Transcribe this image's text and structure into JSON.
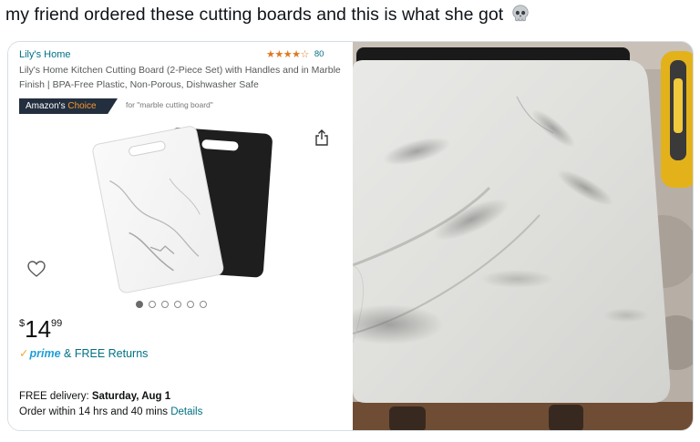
{
  "tweet": {
    "text": "my friend ordered these cutting boards and this is what she got",
    "emoji": "skull-emoji"
  },
  "listing": {
    "brand": "Lily's Home",
    "rating_stars": "★★★★☆",
    "rating_count": "80",
    "title": "Lily's Home Kitchen Cutting Board (2-Piece Set) with Handles and in Marble Finish | BPA-Free Plastic, Non-Porous, Dishwasher Safe",
    "badge_amazons": "Amazon's",
    "badge_choice": "Choice",
    "badge_for": "for \"marble cutting board\"",
    "carousel": {
      "count": 6,
      "active_index": 0
    },
    "price": {
      "currency": "$",
      "whole": "14",
      "fraction": "99"
    },
    "prime_label": "prime",
    "returns_text": "& FREE Returns",
    "delivery_prefix": "FREE delivery:",
    "delivery_date": "Saturday, Aug 1",
    "order_within": "Order within 14 hrs and 40 mins",
    "details_link": "Details"
  },
  "icons": {
    "share": "share-icon",
    "heart": "heart-icon",
    "star": "star-icon"
  },
  "colors": {
    "link": "#007185",
    "badge_bg": "#232f3e",
    "badge_accent": "#f69931",
    "star": "#de7921",
    "prime_blue": "#1f9ed9",
    "prime_check": "#f7a633"
  }
}
